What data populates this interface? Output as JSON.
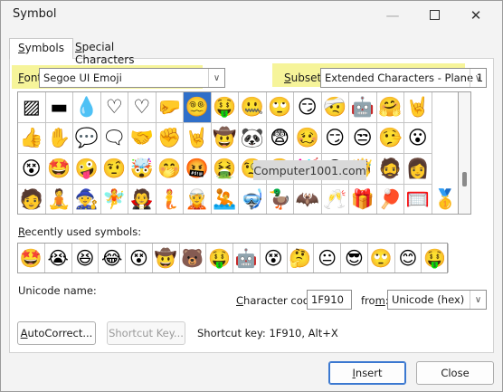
{
  "window": {
    "title": "Symbol",
    "min_icon": "—",
    "close_icon": "✕"
  },
  "tabs": [
    {
      "pre": "",
      "ul": "S",
      "post": "ymbols"
    },
    {
      "pre": "",
      "ul": "S",
      "post": "pecial Characters"
    }
  ],
  "font": {
    "label_ul": "F",
    "label_rest": "ont:",
    "value": "Segoe UI Emoji"
  },
  "subset": {
    "label_pre": "",
    "label_ul": "S",
    "label_rest": "ubset:",
    "value": "Extended Characters - Plane 1"
  },
  "symbols": [
    [
      "▨",
      "▬",
      "💧",
      "♡",
      "♡",
      "🤛",
      "😵‍💫",
      "🤑",
      "🤐",
      "🙄",
      "😏",
      "🤕",
      "🤖",
      "🤗",
      "🤘"
    ],
    [
      "👍",
      "✋",
      "💬",
      "🗨",
      "🤝",
      "✊",
      "🤘",
      "🤠",
      "🐼",
      "😨",
      "🥴",
      "😏",
      "😒",
      "🤥",
      "😮"
    ],
    [
      "😵",
      "🤩",
      "🤪",
      "🤨",
      "🤯",
      "🤭",
      "🤬",
      "🤮",
      "🧐",
      "🤓",
      "🥳",
      "😵",
      "🤴",
      "🧔",
      "👩"
    ],
    [
      "🧑",
      "🧘",
      "🧙",
      "🧚",
      "🧛",
      "🧜",
      "🧝",
      "🤽",
      "🤿",
      "🦆",
      "🦇",
      "🥂",
      "🎁",
      "🏓",
      "🥅",
      "🥇"
    ]
  ],
  "recent_label_ul": "R",
  "recent_label_rest": "ecently used symbols:",
  "recent": [
    "🤩",
    "😭",
    "😆",
    "😂",
    "😵",
    "🤠",
    "🐻",
    "🤑",
    "🤖",
    "😵",
    "🤔",
    "😐",
    "😎",
    "🙄",
    "😊",
    "🤑"
  ],
  "watermark": "Computer1001.com",
  "unicode_name_label": "Unicode name:",
  "char_code": {
    "label_ul": "C",
    "label_rest": "haracter code:",
    "value": "1F910"
  },
  "from": {
    "label_pre": "fro",
    "label_ul": "m",
    "label_rest": ":",
    "value": "Unicode (hex)"
  },
  "buttons": {
    "autocorrect_ul": "A",
    "autocorrect_rest": "utoCorrect...",
    "shortcut_key": "Shortcut Key...",
    "insert_ul": "I",
    "insert_rest": "nsert",
    "close": "Close"
  },
  "shortcut_text": "Shortcut key: 1F910, Alt+X",
  "colors": {
    "highlight": "#f6f49a",
    "selected": "#2f6fc9"
  }
}
